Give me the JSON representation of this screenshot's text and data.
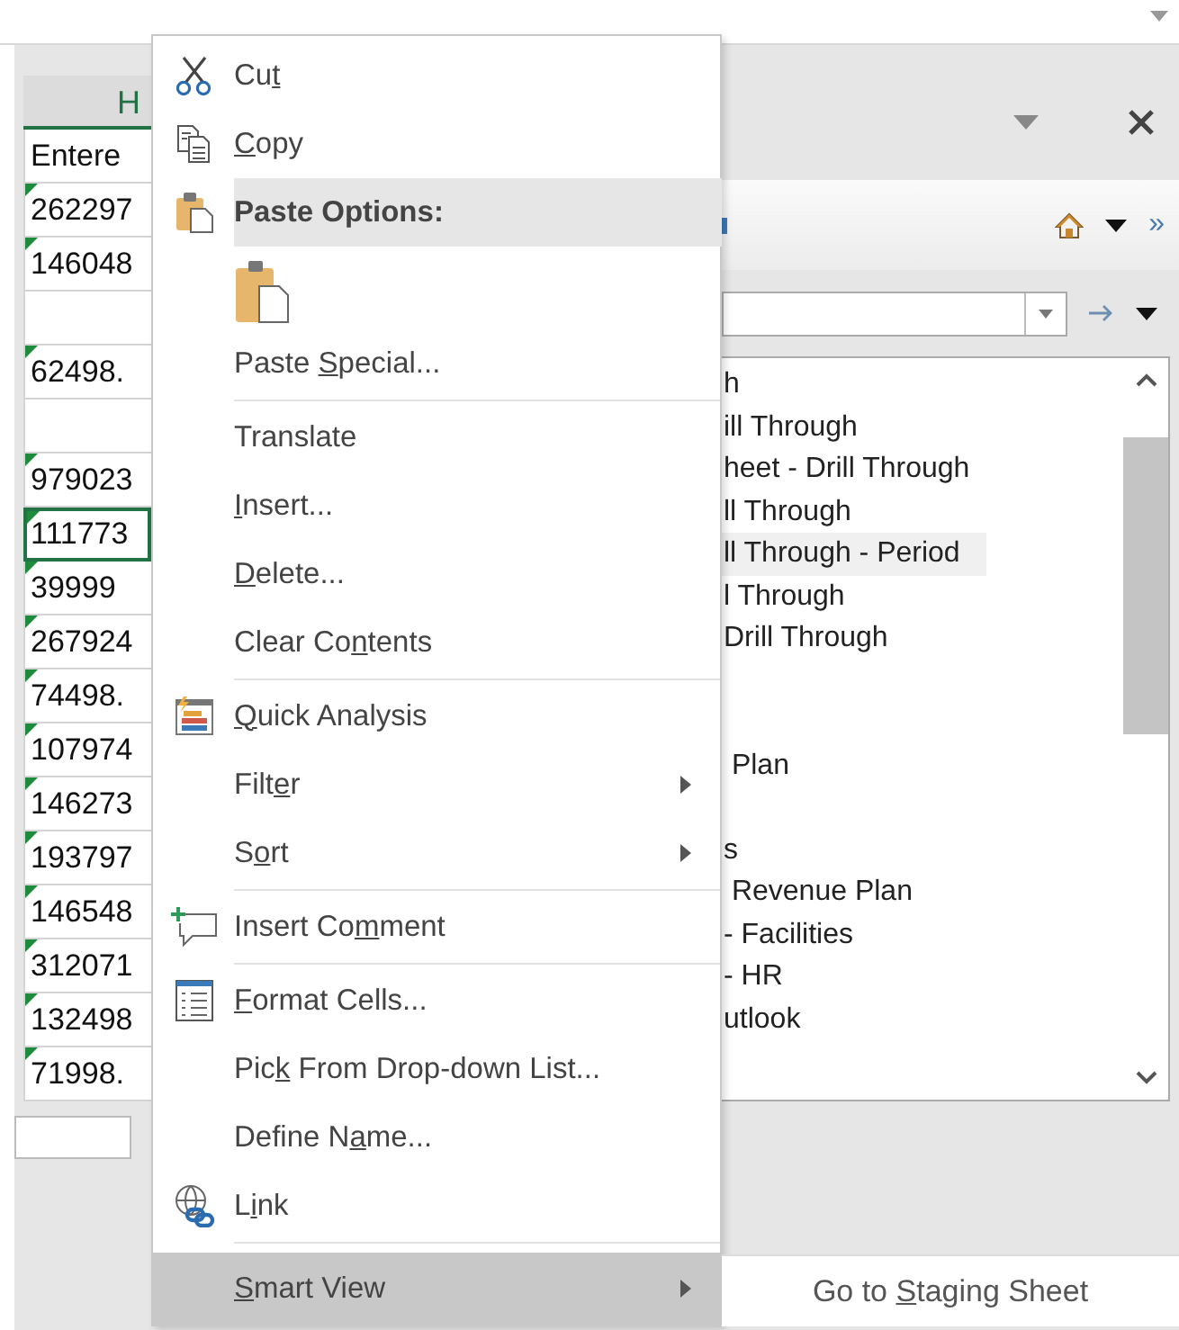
{
  "sheet": {
    "column_header": "H",
    "rows": [
      {
        "kind": "text",
        "value": "Entere",
        "flagged": false,
        "selected": false
      },
      {
        "kind": "text",
        "value": "262297",
        "flagged": true,
        "selected": false
      },
      {
        "kind": "text",
        "value": "146048",
        "flagged": true,
        "selected": false
      },
      {
        "kind": "blank"
      },
      {
        "kind": "text",
        "value": "62498.",
        "flagged": true,
        "selected": false
      },
      {
        "kind": "blank"
      },
      {
        "kind": "text",
        "value": "979023",
        "flagged": true,
        "selected": false
      },
      {
        "kind": "text",
        "value": "111773",
        "flagged": true,
        "selected": true
      },
      {
        "kind": "text",
        "value": "39999",
        "flagged": true,
        "selected": false
      },
      {
        "kind": "text",
        "value": "267924",
        "flagged": true,
        "selected": false
      },
      {
        "kind": "text",
        "value": "74498.",
        "flagged": true,
        "selected": false
      },
      {
        "kind": "text",
        "value": "107974",
        "flagged": true,
        "selected": false
      },
      {
        "kind": "text",
        "value": "146273",
        "flagged": true,
        "selected": false
      },
      {
        "kind": "text",
        "value": "193797",
        "flagged": true,
        "selected": false
      },
      {
        "kind": "text",
        "value": "146548",
        "flagged": true,
        "selected": false
      },
      {
        "kind": "text",
        "value": "312071",
        "flagged": true,
        "selected": false
      },
      {
        "kind": "text",
        "value": "132498",
        "flagged": true,
        "selected": false
      },
      {
        "kind": "text",
        "value": "71998.",
        "flagged": true,
        "selected": false
      }
    ]
  },
  "panel": {
    "toolbar_chevron": "»",
    "list_items": [
      {
        "kind": "text",
        "text": "h",
        "selected": false
      },
      {
        "kind": "text",
        "text": "ill Through",
        "selected": false
      },
      {
        "kind": "text",
        "text": "heet - Drill Through",
        "selected": false
      },
      {
        "kind": "text",
        "text": "ll Through",
        "selected": false
      },
      {
        "kind": "text",
        "text": "ll Through - Period",
        "selected": true
      },
      {
        "kind": "text",
        "text": "l Through",
        "selected": false
      },
      {
        "kind": "text",
        "text": "Drill Through",
        "selected": false
      },
      {
        "kind": "blank"
      },
      {
        "kind": "blank"
      },
      {
        "kind": "text",
        "text": " Plan",
        "selected": false
      },
      {
        "kind": "blank"
      },
      {
        "kind": "text",
        "text": "s",
        "selected": false
      },
      {
        "kind": "text",
        "text": " Revenue Plan",
        "selected": false
      },
      {
        "kind": "text",
        "text": "- Facilities",
        "selected": false
      },
      {
        "kind": "text",
        "text": "- HR",
        "selected": false
      },
      {
        "kind": "text",
        "text": "utlook",
        "selected": false
      }
    ]
  },
  "context_menu": {
    "items": [
      {
        "kind": "item",
        "label": {
          "before": "Cu",
          "key": "t"
        },
        "submenu": false,
        "selected": false
      },
      {
        "kind": "item",
        "label": {
          "key": "C",
          "after": "opy"
        },
        "submenu": false,
        "selected": false
      },
      {
        "kind": "header",
        "text": "Paste Options:"
      },
      {
        "kind": "paste-options"
      },
      {
        "kind": "item",
        "label": {
          "before": "Paste ",
          "key": "S",
          "after": "pecial..."
        },
        "submenu": false,
        "selected": false
      },
      {
        "kind": "separator"
      },
      {
        "kind": "item",
        "label": {
          "before": "Translate"
        },
        "submenu": false,
        "selected": false
      },
      {
        "kind": "item",
        "label": {
          "key": "I",
          "after": "nsert..."
        },
        "submenu": false,
        "selected": false
      },
      {
        "kind": "item",
        "label": {
          "key": "D",
          "after": "elete..."
        },
        "submenu": false,
        "selected": false
      },
      {
        "kind": "item",
        "label": {
          "before": "Clear Co",
          "key": "n",
          "after": "tents"
        },
        "submenu": false,
        "selected": false
      },
      {
        "kind": "separator"
      },
      {
        "kind": "item",
        "label": {
          "key": "Q",
          "after": "uick Analysis"
        },
        "submenu": false,
        "selected": false
      },
      {
        "kind": "item",
        "label": {
          "before": "Filt",
          "key": "e",
          "after": "r"
        },
        "submenu": true,
        "selected": false
      },
      {
        "kind": "item",
        "label": {
          "before": "S",
          "key": "o",
          "after": "rt"
        },
        "submenu": true,
        "selected": false
      },
      {
        "kind": "separator"
      },
      {
        "kind": "item",
        "label": {
          "before": "Insert Co",
          "key": "m",
          "after": "ment"
        },
        "submenu": false,
        "selected": false
      },
      {
        "kind": "separator"
      },
      {
        "kind": "item",
        "label": {
          "key": "F",
          "after": "ormat Cells..."
        },
        "submenu": false,
        "selected": false
      },
      {
        "kind": "item",
        "label": {
          "before": "Pic",
          "key": "k",
          "after": " From Drop-down List..."
        },
        "submenu": false,
        "selected": false
      },
      {
        "kind": "item",
        "label": {
          "before": "Define N",
          "key": "a",
          "after": "me..."
        },
        "submenu": false,
        "selected": false
      },
      {
        "kind": "item",
        "label": {
          "before": "L",
          "key": "i",
          "after": "nk"
        },
        "submenu": false,
        "selected": false
      },
      {
        "kind": "separator"
      },
      {
        "kind": "item",
        "label": {
          "key": "S",
          "after": "mart View"
        },
        "submenu": true,
        "selected": true
      }
    ]
  },
  "submenu": {
    "items": [
      {
        "label": {
          "before": "Go to ",
          "key": "S",
          "after": "taging Sheet"
        },
        "selected": false
      }
    ]
  }
}
